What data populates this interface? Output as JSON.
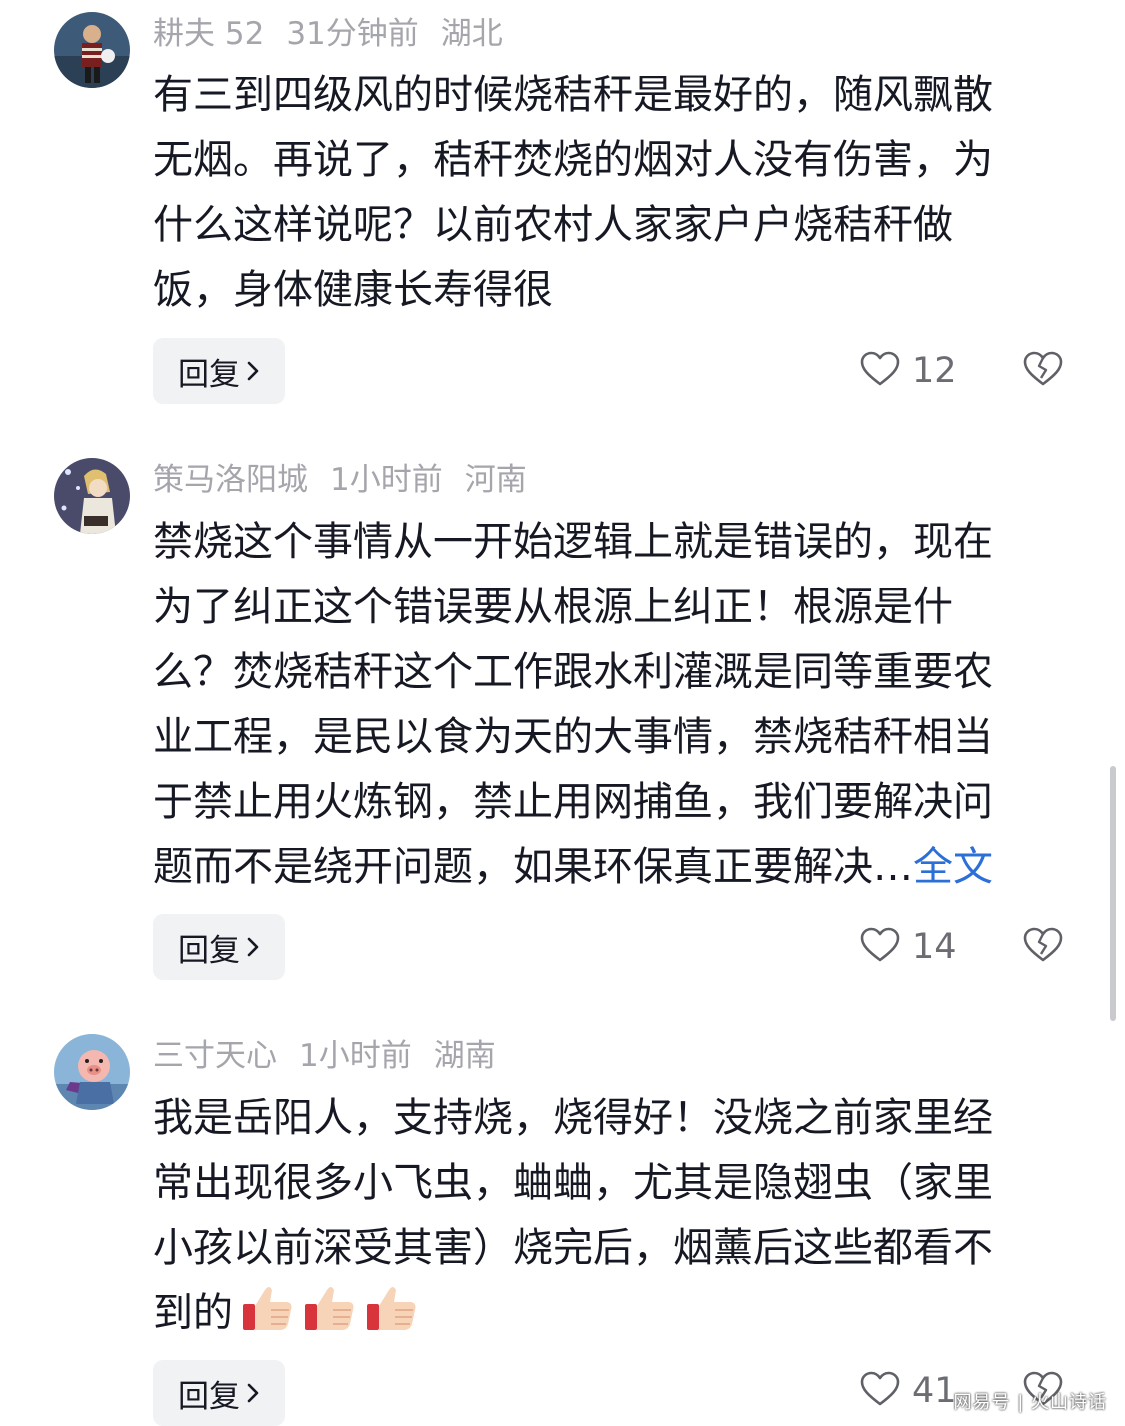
{
  "comments": [
    {
      "username": "耕夫 52",
      "time": "31分钟前",
      "location": "湖北",
      "lines": [
        "有三到四级风的时候烧秸秆是最好的，随风飘散",
        "无烟。再说了，秸秆焚烧的烟对人没有伤害，为",
        "什么这样说呢？以前农村人家家户户烧秸秆做",
        "饭，身体健康长寿得很"
      ],
      "reply_label": "回复",
      "likes": "12"
    },
    {
      "username": "策马洛阳城",
      "time": "1小时前",
      "location": "河南",
      "lines": [
        "禁烧这个事情从一开始逻辑上就是错误的，现在",
        "为了纠正这个错误要从根源上纠正！根源是什",
        "么？焚烧秸秆这个工作跟水利灌溉是同等重要农",
        "业工程，是民以食为天的大事情，禁烧秸秆相当",
        "于禁止用火炼钢，禁止用网捕鱼，我们要解决问",
        "题而不是绕开问题，如果环保真正要解决…"
      ],
      "more_label": "全文",
      "reply_label": "回复",
      "likes": "14"
    },
    {
      "username": "三寸天心",
      "time": "1小时前",
      "location": "湖南",
      "lines": [
        "我是岳阳人，支持烧，烧得好！没烧之前家里经",
        "常出现很多小飞虫，蛐蛐，尤其是隐翅虫（家里",
        "小孩以前深受其害）烧完后，烟薰后这些都看不",
        "到的"
      ],
      "reply_label": "回复",
      "likes": "41"
    }
  ],
  "watermark": "网易号 | 火山诗话",
  "icons": {
    "like": "heart-outline-icon",
    "dislike": "broken-heart-icon",
    "reply": "chevron-right-icon",
    "emoji": "thumbs-up-emoji"
  },
  "colors": {
    "text": "#161823",
    "meta": "#a4a6ac",
    "link": "#2c6fd6",
    "reply_bg": "#f1f2f4"
  }
}
